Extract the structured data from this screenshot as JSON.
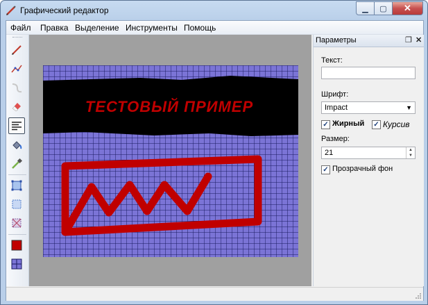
{
  "window": {
    "title": "Графический редактор"
  },
  "menu": {
    "items": [
      "Файл",
      "Правка",
      "Выделение",
      "Инструменты",
      "Помощь"
    ]
  },
  "toolbar": {
    "tools": [
      "pencil-icon",
      "polyline-icon",
      "curve-icon",
      "eraser-icon",
      "text-tool-icon",
      "fill-bucket-icon",
      "eyedropper-icon",
      "rect-select-icon",
      "select-icon",
      "crop-icon",
      "fg-color-swatch",
      "bg-pattern-swatch"
    ],
    "active": "text-tool-icon",
    "fg_color": "#c00000",
    "bg_color": "#7b74d6"
  },
  "canvas": {
    "text": "ТЕСТОВЫЙ ПРИМЕР",
    "text_color": "#c00000",
    "band_color": "#000000",
    "background_color": "#7b74d6",
    "grid_color": "#1a1a60",
    "stroke_color": "#c00000"
  },
  "panel": {
    "title": "Параметры",
    "text_label": "Текст:",
    "text_value": "",
    "font_label": "Шрифт:",
    "font_value": "Impact",
    "bold_label": "Жирный",
    "bold_checked": true,
    "italic_label": "Курсив",
    "italic_checked": true,
    "size_label": "Размер:",
    "size_value": "21",
    "transparent_label": "Прозрачный фон",
    "transparent_checked": true
  }
}
